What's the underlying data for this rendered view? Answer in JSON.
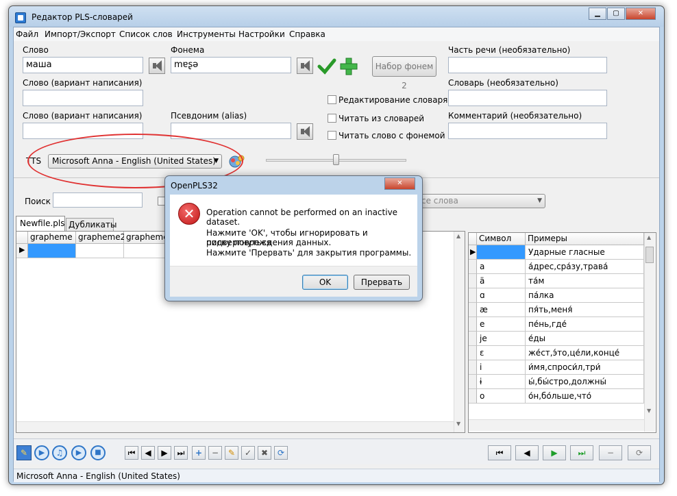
{
  "window": {
    "title": "Редактор PLS-словарей"
  },
  "menu": [
    "Файл",
    "Импорт/Экспорт",
    "Список слов",
    "Инструменты",
    "Настройки",
    "Справка"
  ],
  "form": {
    "word_label": "Слово",
    "word_value": "маша",
    "phoneme_label": "Фонема",
    "phoneme_value": "mɐʂə",
    "phoneme_set_button": "Набор фонем 2",
    "part_of_speech_label": "Часть речи (необязательно)",
    "variant1_label": "Слово (вариант написания)",
    "variant2_label": "Слово (вариант написания)",
    "alias_label": "Псевдоним (alias)",
    "dictionary_label": "Словарь (необязательно)",
    "comment_label": "Комментарий (необязательно)",
    "edit_dict_label": "Редактирование словаря",
    "read_from_dict_label": "Читать из словарей",
    "read_with_phoneme_label": "Читать слово с фонемой",
    "tts_label": "TTS",
    "tts_voice": "Microsoft Anna - English (United States)"
  },
  "search": {
    "label": "Поиск",
    "combo_placeholder": "се слова"
  },
  "tabs": [
    "Newfile.pls",
    "Дубликаты"
  ],
  "main_grid": {
    "columns": [
      "grapheme",
      "grapheme2",
      "grapheme3"
    ]
  },
  "symbol_grid": {
    "columns": [
      "Символ",
      "Примеры"
    ],
    "rows": [
      {
        "symbol": "",
        "examples": "Ударные гласные"
      },
      {
        "symbol": "a",
        "examples": "а́дрес,сра́зу,трава́"
      },
      {
        "symbol": "ä",
        "examples": "та́м"
      },
      {
        "symbol": "ɑ",
        "examples": "па́лка"
      },
      {
        "symbol": "æ",
        "examples": "пя́ть,меня́"
      },
      {
        "symbol": "e",
        "examples": "пе́нь,где́"
      },
      {
        "symbol": "je",
        "examples": "е́ды"
      },
      {
        "symbol": "ɛ",
        "examples": "же́ст,э́то,це́ли,конце́"
      },
      {
        "symbol": "i",
        "examples": "и́мя,спроси́л,три́"
      },
      {
        "symbol": "ɨ",
        "examples": "ы́,бы́стро,должны́"
      },
      {
        "symbol": "o",
        "examples": "о́н,бо́льше,что́"
      }
    ]
  },
  "status": {
    "text": "Microsoft Anna - English (United States)"
  },
  "dialog": {
    "title": "OpenPLS32",
    "message": "Operation cannot be performed on an inactive dataset.",
    "line1": "Нажмите 'OK', чтобы игнорировать и подвергнуться",
    "line2": "риску повреждения данных.",
    "line3": "Нажмите 'Прервать' для закрытия программы.",
    "ok": "OK",
    "abort": "Прервать"
  }
}
